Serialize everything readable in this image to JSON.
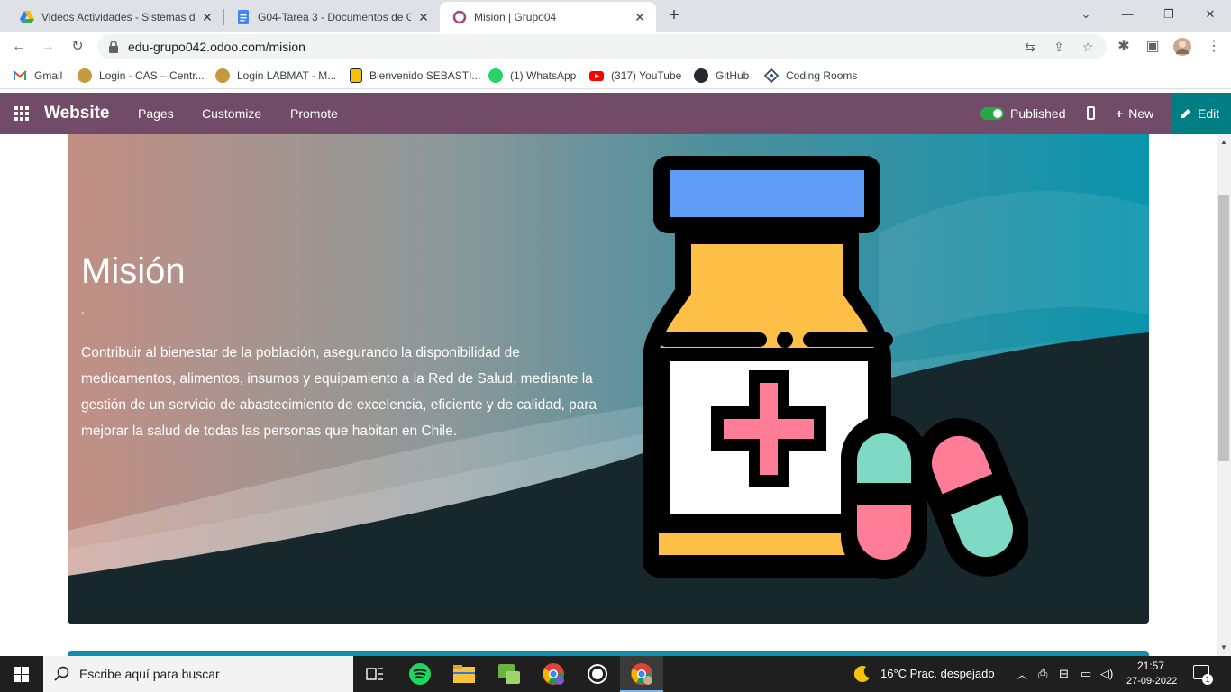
{
  "browser": {
    "tabs": [
      {
        "title": "Videos Actividades - Sistemas de",
        "icon": "google-drive-icon",
        "active": false
      },
      {
        "title": "G04-Tarea 3 - Documentos de Go",
        "icon": "google-docs-icon",
        "active": false
      },
      {
        "title": "Mision | Grupo04",
        "icon": "odoo-icon",
        "active": true
      }
    ],
    "url": "edu-grupo042.odoo.com/mision",
    "bookmarks": [
      {
        "label": "Gmail",
        "icon": "gmail-icon"
      },
      {
        "label": "Login - CAS – Centr...",
        "icon": "cas-icon"
      },
      {
        "label": "Login LABMAT - M...",
        "icon": "labmat-icon"
      },
      {
        "label": "Bienvenido SEBASTI...",
        "icon": "info-icon"
      },
      {
        "label": "(1) WhatsApp",
        "icon": "whatsapp-icon"
      },
      {
        "label": "(317) YouTube",
        "icon": "youtube-icon"
      },
      {
        "label": "GitHub",
        "icon": "github-icon"
      },
      {
        "label": "Coding Rooms",
        "icon": "coding-rooms-icon"
      }
    ]
  },
  "odoo": {
    "brand": "Website",
    "menu": [
      "Pages",
      "Customize",
      "Promote"
    ],
    "published_label": "Published",
    "new_label": "New",
    "edit_label": "Edit"
  },
  "hero": {
    "title": "Misión",
    "separator": "-",
    "text": "Contribuir al bienestar de la población, asegurando la disponibilidad de medicamentos, alimentos, insumos y equipamiento a la Red de Salud, mediante la gestión de un servicio de abastecimiento de excelencia, eficiente y de calidad, para mejorar la salud de todas las personas que habitan en Chile."
  },
  "taskbar": {
    "search_placeholder": "Escribe aquí para buscar",
    "weather": "16°C  Prac. despejado",
    "time": "21:57",
    "date": "27-09-2022",
    "notifications": "1"
  },
  "colors": {
    "odoo_purple": "#714b67",
    "odoo_teal": "#017e84",
    "hero_dark": "#17282d",
    "bottle_cap": "#5e9cf5",
    "bottle_body": "#fdbf45",
    "cross": "#ff7d96",
    "pill_green": "#7ed9c5"
  }
}
